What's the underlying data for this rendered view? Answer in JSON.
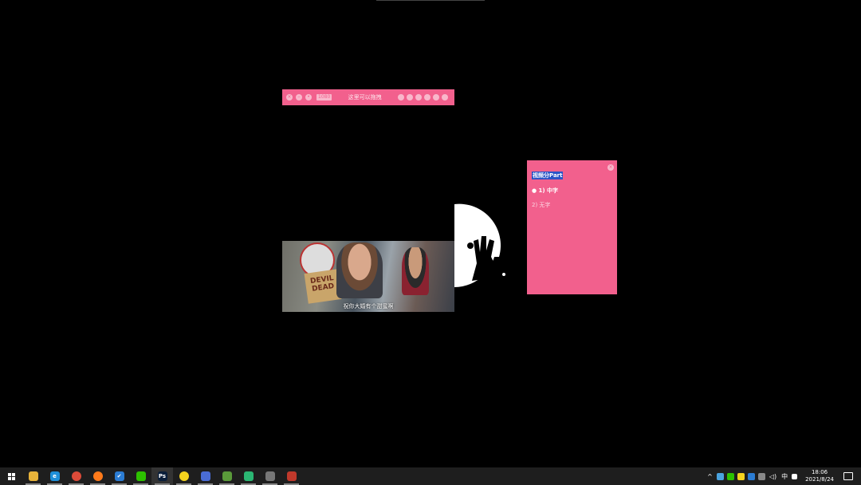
{
  "player": {
    "drag_label": "这里可以拖拽",
    "quality_chip": "1080"
  },
  "video": {
    "subtitle": "祝你大婚有个甜蜜啊"
  },
  "panel": {
    "title": "视频分Part",
    "items": [
      {
        "label": "● 1) 中字"
      },
      {
        "label": "2) 无字"
      }
    ]
  },
  "taskbar": {
    "apps": [
      {
        "name": "file-explorer",
        "color": "#e8b33a",
        "glyph": ""
      },
      {
        "name": "edge",
        "color": "#1f8fd8",
        "glyph": "e"
      },
      {
        "name": "chrome",
        "color": "#dd4b39",
        "glyph": ""
      },
      {
        "name": "firefox",
        "color": "#ff7a1a",
        "glyph": ""
      },
      {
        "name": "todo",
        "color": "#2b7cd3",
        "glyph": "✔"
      },
      {
        "name": "wechat",
        "color": "#2dc100",
        "glyph": ""
      },
      {
        "name": "photoshop",
        "color": "#0a1e3a",
        "glyph": "Ps"
      },
      {
        "name": "qq-music",
        "color": "#f5d31e",
        "glyph": ""
      },
      {
        "name": "remote-app",
        "color": "#4a6cd4",
        "glyph": ""
      },
      {
        "name": "notepad-app",
        "color": "#5a9a3a",
        "glyph": ""
      },
      {
        "name": "green-app",
        "color": "#2bb673",
        "glyph": ""
      },
      {
        "name": "pen-app",
        "color": "#777777",
        "glyph": ""
      },
      {
        "name": "tool-app",
        "color": "#c0392b",
        "glyph": ""
      }
    ],
    "ime": "中",
    "time": "18:06",
    "date": "2021/8/24"
  },
  "colors": {
    "accent": "#f2608d",
    "highlight": "#2b55c7",
    "taskbar": "#1e1e1e"
  }
}
